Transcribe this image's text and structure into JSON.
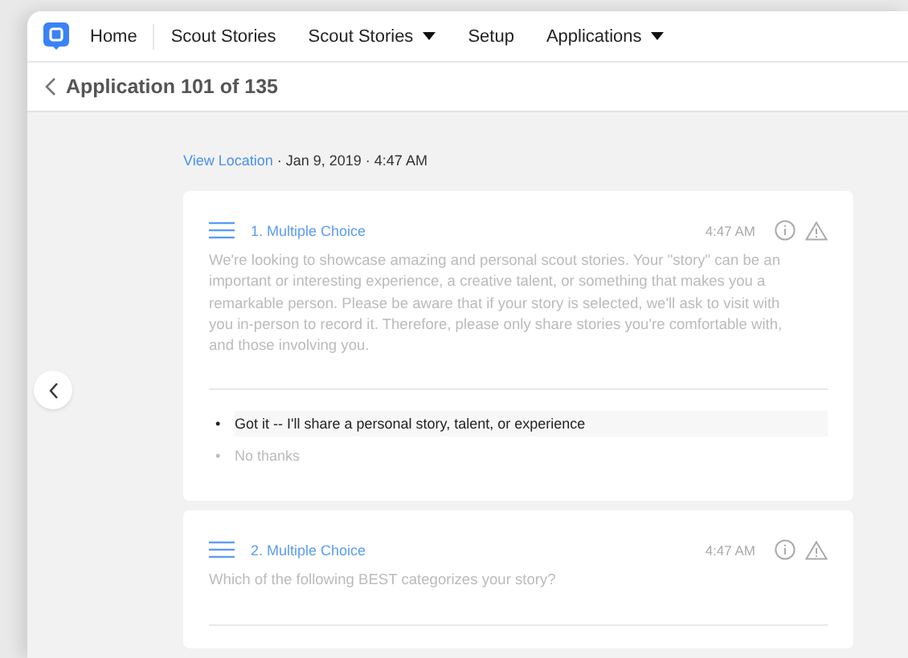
{
  "nav": {
    "items": [
      {
        "label": "Home",
        "dropdown": false
      },
      {
        "label": "Scout Stories",
        "dropdown": false
      },
      {
        "label": "Scout Stories",
        "dropdown": true
      },
      {
        "label": "Setup",
        "dropdown": false
      },
      {
        "label": "Applications",
        "dropdown": true
      }
    ]
  },
  "header": {
    "title": "Application 101 of 135"
  },
  "meta": {
    "link": "View Location",
    "text": "· Jan 9, 2019 · 4:47 AM"
  },
  "questions": [
    {
      "title": "1. Multiple Choice",
      "time": "4:47 AM",
      "text": "We're looking to showcase amazing and personal scout stories. Your \"story\" can be an important or interesting experience, a creative talent, or something that makes you a remarkable person. Please be aware that if your story is selected, we'll ask to visit with you in-person to record it. Therefore, please only share stories you're comfortable with, and those involving you.",
      "options": [
        {
          "marker": "•",
          "label": "Got it -- I'll share a personal story, talent, or experience",
          "selected": true
        },
        {
          "marker": "•",
          "label": "No thanks",
          "selected": false
        }
      ]
    },
    {
      "title": "2. Multiple Choice",
      "time": "4:47 AM",
      "text": "Which of the following BEST categorizes your story?"
    }
  ]
}
